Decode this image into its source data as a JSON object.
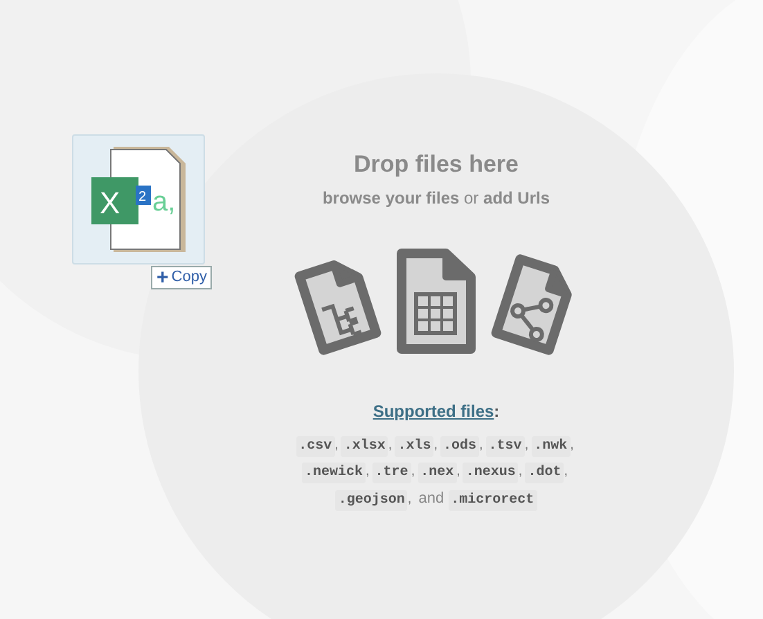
{
  "drop_zone": {
    "title": "Drop files here",
    "browse_link": "browse your files",
    "or_text": "or",
    "urls_link": "add Urls"
  },
  "dragged_file": {
    "icon_letter": "X",
    "icon_badge": "2",
    "icon_tail": "a,",
    "badge_plus": "+",
    "badge_label": "Copy"
  },
  "supported": {
    "link": "Supported files",
    "colon": ":",
    "lines": [
      [
        {
          "code": ".csv",
          "sep": ","
        },
        {
          "code": ".xlsx",
          "sep": ","
        },
        {
          "code": ".xls",
          "sep": ","
        },
        {
          "code": ".ods",
          "sep": ","
        },
        {
          "code": ".tsv",
          "sep": ","
        },
        {
          "code": ".nwk",
          "sep": ","
        }
      ],
      [
        {
          "code": ".newick",
          "sep": ","
        },
        {
          "code": ".tre",
          "sep": ","
        },
        {
          "code": ".nex",
          "sep": ","
        },
        {
          "code": ".nexus",
          "sep": ","
        },
        {
          "code": ".dot",
          "sep": ","
        }
      ],
      [
        {
          "code": ".geojson",
          "sep": ","
        },
        {
          "word": "and"
        },
        {
          "code": ".microrect"
        }
      ]
    ]
  }
}
